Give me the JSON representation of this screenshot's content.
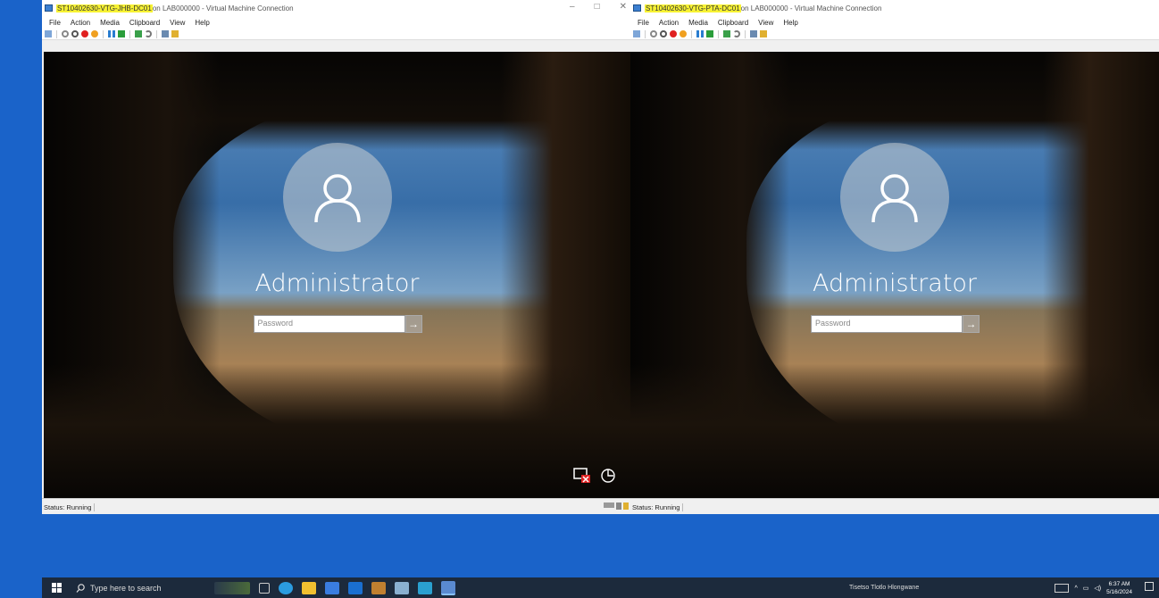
{
  "window1": {
    "title_highlight": "ST10402630-VTG-JHB-DC01",
    "title_rest": " on LAB000000 - Virtual Machine Connection",
    "menus": [
      "File",
      "Action",
      "Media",
      "Clipboard",
      "View",
      "Help"
    ],
    "username": "Administrator",
    "password_placeholder": "Password",
    "status": "Status: Running",
    "window_controls": [
      "–",
      "□",
      "✕"
    ]
  },
  "window2": {
    "title_highlight": "ST10402630-VTG-PTA-DC01",
    "title_rest": " on LAB000000 - Virtual Machine Connection",
    "menus": [
      "File",
      "Action",
      "Media",
      "Clipboard",
      "View",
      "Help"
    ],
    "username": "Administrator",
    "password_placeholder": "Password",
    "status": "Status: Running"
  },
  "taskbar": {
    "search_placeholder": "Type here to search",
    "user": "Tisetso Tlotlo Hlongwane",
    "time": "6:37 AM",
    "date": "5/16/2024"
  },
  "colors": {
    "highlight": "#f7f233",
    "taskbar": "#1c2a3c",
    "desktop": "#1a63c9"
  }
}
